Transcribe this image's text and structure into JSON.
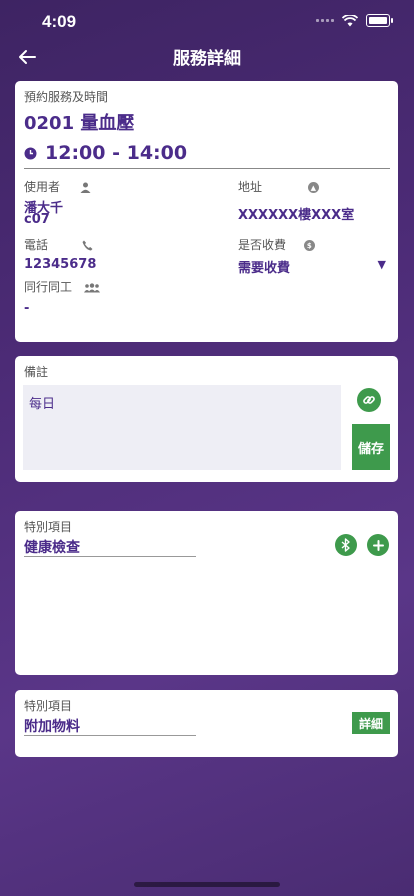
{
  "status_bar": {
    "time": "4:09"
  },
  "nav": {
    "title": "服務詳細"
  },
  "service": {
    "section_label": "預約服務及時間",
    "code": "0201",
    "name": "量血壓",
    "time_range": "12:00 - 14:00",
    "user_label": "使用者",
    "user_name": "潘大千",
    "user_code": "c07",
    "address_label": "地址",
    "address_value": "XXXXXX樓XXX室",
    "phone_label": "電話",
    "phone_value": "12345678",
    "charge_label": "是否收費",
    "charge_value": "需要收費",
    "companion_label": "同行同工",
    "companion_value": "-"
  },
  "remarks": {
    "label": "備註",
    "text": "每日",
    "save_label": "儲存"
  },
  "special1": {
    "label": "特別項目",
    "value": "健康檢查"
  },
  "special2": {
    "label": "特別項目",
    "value": "附加物料",
    "detail_label": "詳細"
  },
  "colors": {
    "accent_purple": "#4b2c8a",
    "green": "#3e9a4c",
    "background": "#4c2b76"
  }
}
